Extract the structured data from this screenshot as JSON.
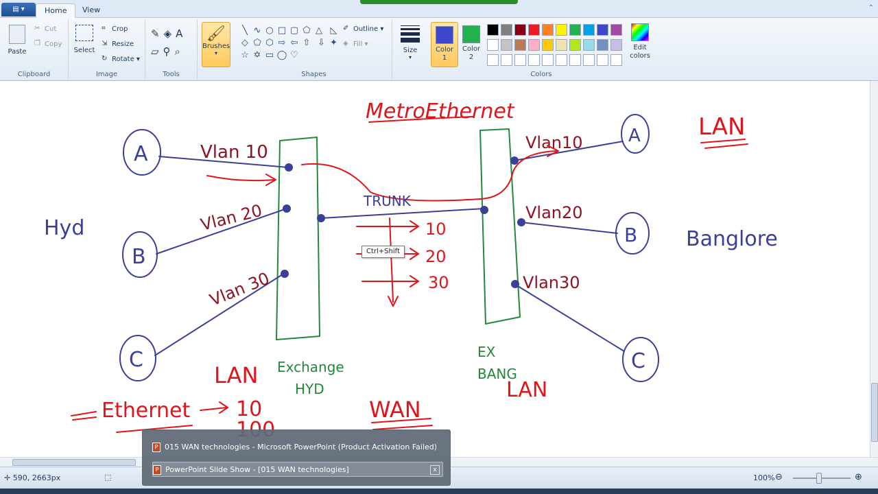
{
  "ribbon": {
    "tabs": [
      {
        "label": "Home"
      },
      {
        "label": "View"
      }
    ],
    "clipboard": {
      "paste": "Paste",
      "cut": "Cut",
      "copy": "Copy",
      "label": "Clipboard"
    },
    "image": {
      "select": "Select",
      "crop": "Crop",
      "resize": "Resize",
      "rotate": "Rotate",
      "label": "Image"
    },
    "tools": {
      "label": "Tools"
    },
    "brushes": {
      "label": "Brushes"
    },
    "shapes": {
      "outline": "Outline",
      "fill": "Fill",
      "label": "Shapes"
    },
    "size": {
      "label": "Size"
    },
    "colors": {
      "color1": "Color 1",
      "color2": "Color 2",
      "edit": "Edit colors",
      "label": "Colors",
      "color1_value": "#3f48cc",
      "color2_value": "#22b14c",
      "palette": [
        "#000000",
        "#7f7f7f",
        "#880015",
        "#ed1c24",
        "#ff7f27",
        "#fff200",
        "#22b14c",
        "#00a2e8",
        "#3f48cc",
        "#a349a4",
        "#ffffff",
        "#c3c3c3",
        "#b97a57",
        "#ffaec9",
        "#ffc90e",
        "#efe4b0",
        "#b5e61d",
        "#99d9ea",
        "#7092be",
        "#c8bfe7",
        "#ffffff",
        "#ffffff",
        "#ffffff",
        "#ffffff",
        "#ffffff",
        "#ffffff",
        "#ffffff",
        "#ffffff",
        "#ffffff",
        "#ffffff"
      ]
    }
  },
  "canvas": {
    "title": "MetroEthernet",
    "left_city": "Hyd",
    "right_city": "Banglore",
    "lan_top": "LAN",
    "lan_left": "LAN",
    "lan_right": "LAN",
    "wan": "WAN",
    "trunk": "TRUNK",
    "left_switch_label": "Exchange\nHYD",
    "right_switch_label": "EX\nBANG",
    "left_vlans": [
      "Vlan 10",
      "Vlan 20",
      "Vlan 30"
    ],
    "right_vlans": [
      "Vlan10",
      "Vlan20",
      "Vlan30"
    ],
    "left_nodes": [
      "A",
      "B",
      "C"
    ],
    "right_nodes": [
      "A",
      "B",
      "C"
    ],
    "tag_numbers": [
      "10",
      "20",
      "30"
    ],
    "ethernet": "Ethernet",
    "ethernet_speeds": [
      "10",
      "100"
    ]
  },
  "tooltip": "Ctrl+Shift",
  "popup": {
    "item1": "015 WAN technologies - Microsoft PowerPoint (Product Activation Failed)",
    "item2": "PowerPoint Slide Show - [015 WAN technologies]",
    "close": "x"
  },
  "status": {
    "coords": "590, 2663px",
    "zoom": "100%"
  }
}
